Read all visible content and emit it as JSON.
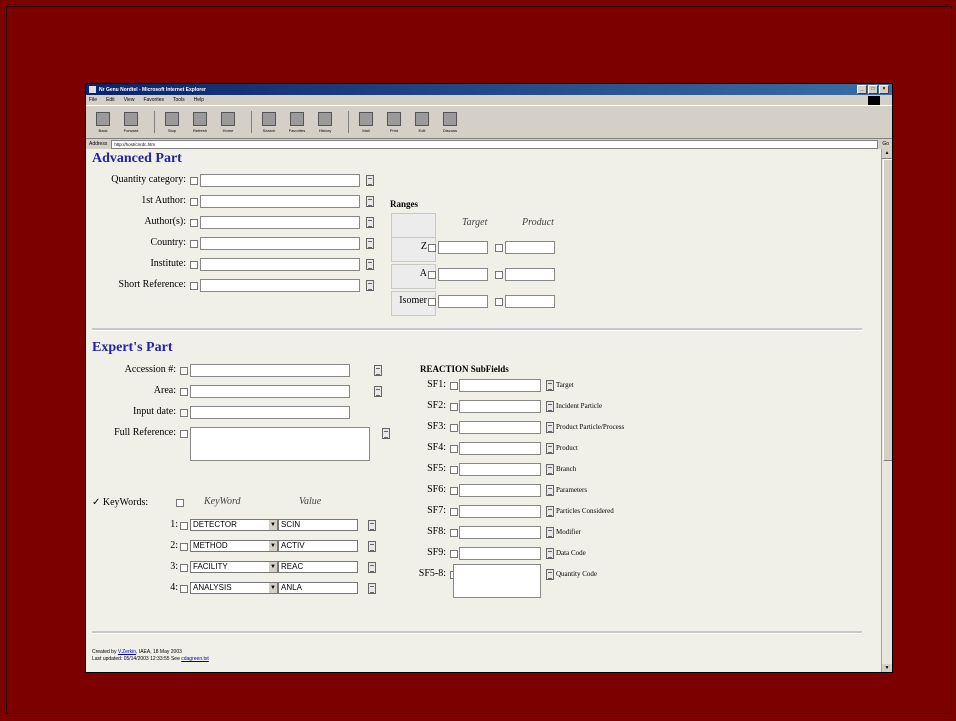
{
  "window": {
    "title": "Nr Genu Nordtel - Microsoft Internet Explorer"
  },
  "menu": [
    "File",
    "Edit",
    "View",
    "Favorites",
    "Tools",
    "Help"
  ],
  "toolbar": [
    "Back",
    "Forward",
    "Stop",
    "Refresh",
    "Home",
    "Search",
    "Favorites",
    "History",
    "Mail",
    "Print",
    "Edit",
    "Discuss"
  ],
  "address": {
    "label": "Address",
    "url": "http://host/cnrdc.htm",
    "go": "Go"
  },
  "advanced": {
    "title": "Advanced Part",
    "fields": [
      "Quantity category:",
      "1st Author:",
      "Author(s):",
      "Country:",
      "Institute:",
      "Short Reference:"
    ],
    "ranges": {
      "title": "Ranges",
      "cols": [
        "Target",
        "Product"
      ],
      "rows": [
        "Z",
        "A",
        "Isomer"
      ]
    }
  },
  "experts": {
    "title": "Expert's Part",
    "fields": [
      "Accession #:",
      "Area:",
      "Input date:",
      "Full Reference:"
    ],
    "keywords": {
      "label": "✓ KeyWords:",
      "col_key": "KeyWord",
      "col_val": "Value",
      "rows": [
        {
          "n": "1:",
          "key": "DETECTOR",
          "val": "SCIN"
        },
        {
          "n": "2:",
          "key": "METHOD",
          "val": "ACTIV"
        },
        {
          "n": "3:",
          "key": "FACILITY",
          "val": "REAC"
        },
        {
          "n": "4:",
          "key": "ANALYSIS",
          "val": "ANLA"
        }
      ]
    },
    "reaction": {
      "title": "REACTION SubFields",
      "rows": [
        {
          "sf": "SF1:",
          "desc": "Target"
        },
        {
          "sf": "SF2:",
          "desc": "Incident Particle"
        },
        {
          "sf": "SF3:",
          "desc": "Product Particle/Process"
        },
        {
          "sf": "SF4:",
          "desc": "Product"
        },
        {
          "sf": "SF5:",
          "desc": "Branch"
        },
        {
          "sf": "SF6:",
          "desc": "Parameters"
        },
        {
          "sf": "SF7:",
          "desc": "Particles Considered"
        },
        {
          "sf": "SF8:",
          "desc": "Modifier"
        },
        {
          "sf": "SF9:",
          "desc": "Data Code"
        },
        {
          "sf": "SF5-8:",
          "desc": "Quantity Code"
        }
      ]
    }
  },
  "footer": {
    "created_pre": "Created by",
    "created_link": "V.Zerkin",
    "created_post": ", IAEA, 18 May 2003",
    "updated_pre": "Last updated: 05/14/2003 12:33:55 See",
    "updated_link": "cdagreen.txt"
  }
}
